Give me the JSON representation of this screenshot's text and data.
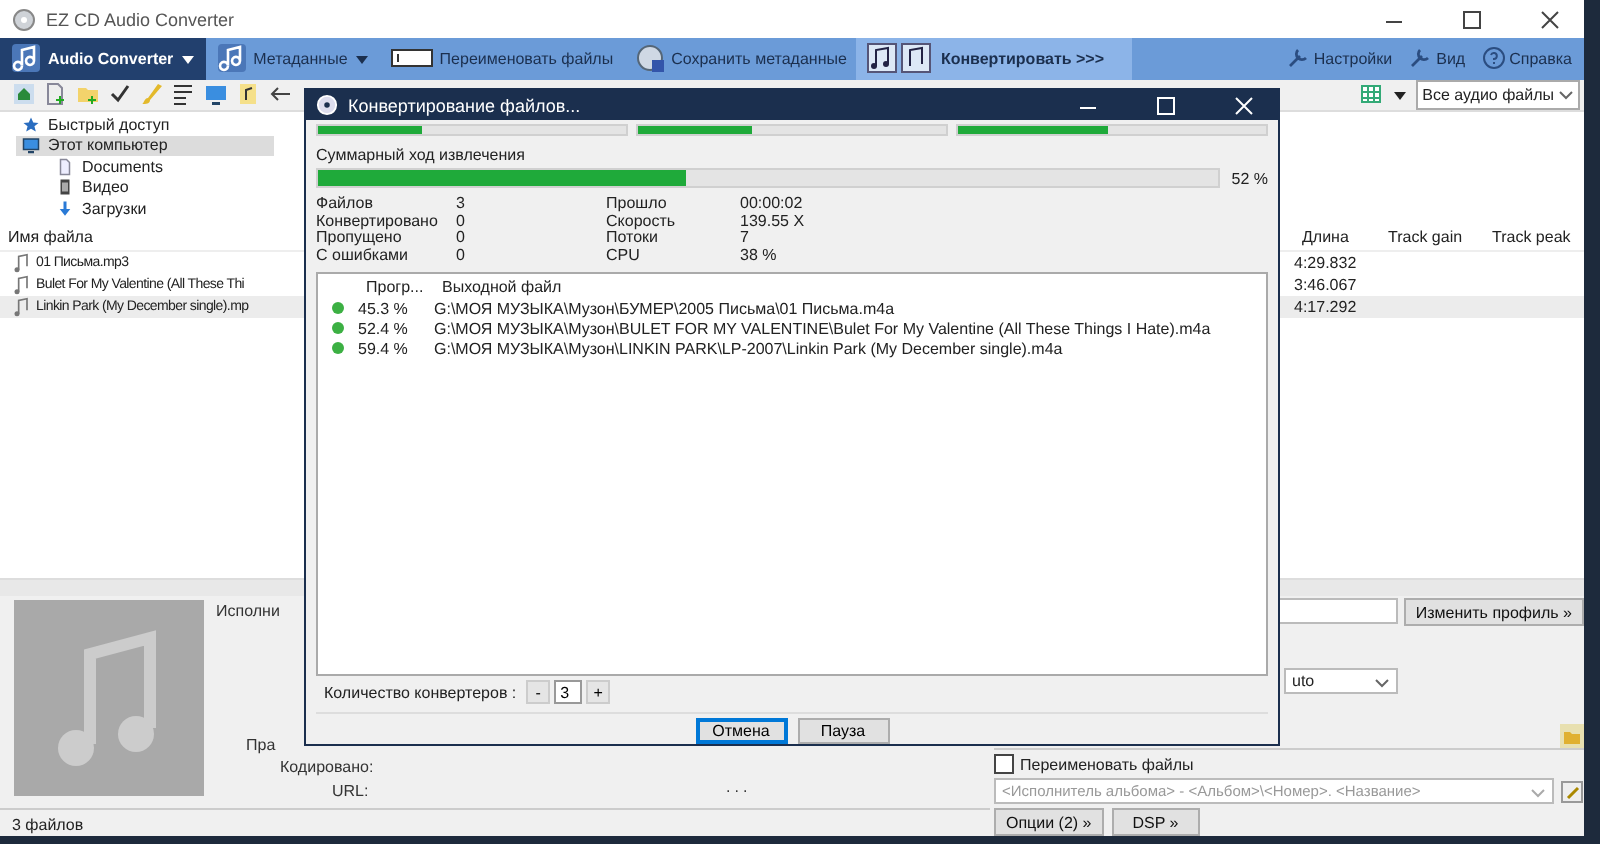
{
  "window": {
    "title": "EZ CD Audio Converter"
  },
  "ribbon": {
    "items": [
      {
        "label": "Audio Converter",
        "kind": "menu",
        "selected": true
      },
      {
        "label": "Метаданные",
        "kind": "menu",
        "selected": false
      },
      {
        "label": "Переименовать файлы",
        "kind": "rename",
        "selected": false
      },
      {
        "label": "Сохранить метаданные",
        "kind": "save",
        "selected": false
      },
      {
        "label": "Конвертировать >>>",
        "kind": "convert",
        "selected": false
      }
    ],
    "links": [
      "Настройки",
      "Вид",
      "Справка"
    ]
  },
  "filter": {
    "value": "Все аудио файлы"
  },
  "tree": [
    {
      "label": "Быстрый доступ",
      "kind": "star",
      "selected": false
    },
    {
      "label": "Этот компьютер",
      "kind": "pc",
      "selected": true,
      "children": [
        {
          "label": "Documents",
          "kind": "doc",
          "selected": false
        },
        {
          "label": "Видео",
          "kind": "video",
          "selected": false
        },
        {
          "label": "Загрузки",
          "kind": "download",
          "selected": false
        }
      ]
    }
  ],
  "files": {
    "columns": [
      "Имя файла",
      "Длина",
      "Track gain",
      "Track peak"
    ],
    "rows": [
      {
        "name": "01 Письма.mp3",
        "length": "4:29.832",
        "selected": false
      },
      {
        "name": "Bulet For My Valentine (All These Thi",
        "length": "3:46.067",
        "selected": false
      },
      {
        "name": "Linkin Park (My December single).mp",
        "length": "4:17.292",
        "selected": true
      }
    ]
  },
  "tags": {
    "labels": [
      "Исполни",
      "Пра",
      "Кодировано:",
      "URL:"
    ],
    "url_value": "..."
  },
  "output": {
    "profile_button": "Изменить профиль »",
    "format": "uto",
    "rename": {
      "label": "Переименовать файлы",
      "checked": false
    },
    "pattern": "<Исполнитель альбома> - <Альбом>\\<Номер>. <Название>",
    "buttons": [
      "Опции (2) »",
      "DSP »"
    ]
  },
  "status_bar": "3 файлов",
  "dialog": {
    "title": "Конвертирование файлов...",
    "threads": [
      {
        "level": 0.34
      },
      {
        "level": 0.37
      },
      {
        "level": 0.49
      }
    ],
    "total": {
      "label": "Суммарный ход извлечения",
      "level": 0.41,
      "reading": "52 %"
    },
    "stats": [
      {
        "label": "Файлов",
        "value": "3"
      },
      {
        "label": "Прошло",
        "value": "00:00:02"
      },
      {
        "label": "Конвертировано",
        "value": "0"
      },
      {
        "label": "Скорость",
        "value": "139.55 X"
      },
      {
        "label": "Пропущено",
        "value": "0"
      },
      {
        "label": "Потоки",
        "value": "7"
      },
      {
        "label": "С ошибками",
        "value": "0"
      },
      {
        "label": "CPU",
        "value": "38 %"
      }
    ],
    "columns": [
      "Прогр...",
      "Выходной файл"
    ],
    "jobs": [
      {
        "progress": "45.3 %",
        "file": "G:\\МОЯ МУЗЫКА\\Музон\\БУМЕР\\2005 Письма\\01 Письма.m4a",
        "color": "#3cb043"
      },
      {
        "progress": "52.4 %",
        "file": "G:\\МОЯ МУЗЫКА\\Музон\\BULET FOR MY VALENTINE\\Bulet For My Valentine (All These Things I Hate).m4a",
        "color": "#3cb043"
      },
      {
        "progress": "59.4 %",
        "file": "G:\\МОЯ МУЗЫКА\\Музон\\LINKIN PARK\\LP-2007\\Linkin Park (My December single).m4a",
        "color": "#3cb043"
      }
    ],
    "converters": {
      "label": "Количество конвертеров :",
      "minus": "-",
      "value": "3",
      "plus": "+"
    },
    "buttons": [
      {
        "label": "Отмена",
        "default": true
      },
      {
        "label": "Пауза",
        "default": false
      }
    ]
  }
}
